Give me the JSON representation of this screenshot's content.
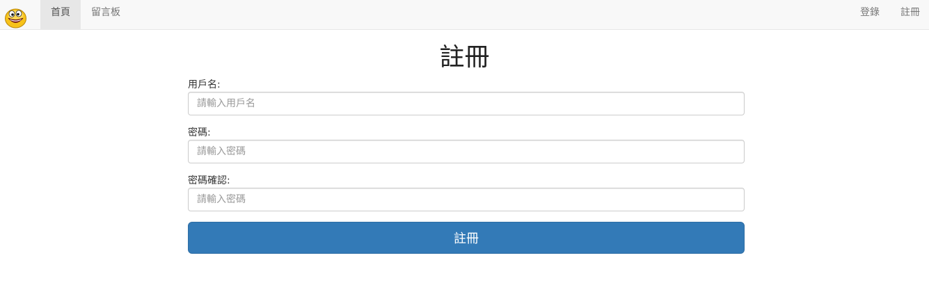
{
  "colors": {
    "navbar_bg": "#f8f8f8",
    "nav_active_bg": "#e7e7e7",
    "primary_button": "#337ab7",
    "logo_face": "#f7c21a"
  },
  "navbar": {
    "logo_icon": "smiley-face-icon",
    "left_items": [
      {
        "label": "首頁",
        "active": true
      },
      {
        "label": "留言板",
        "active": false
      }
    ],
    "right_items": [
      {
        "label": "登錄"
      },
      {
        "label": "註冊"
      }
    ]
  },
  "page_title": "註冊",
  "form": {
    "username": {
      "label": "用戶名:",
      "placeholder": "請輸入用戶名",
      "value": ""
    },
    "password": {
      "label": "密碼:",
      "placeholder": "請輸入密碼",
      "value": ""
    },
    "password_confirm": {
      "label": "密碼確認:",
      "placeholder": "請輸入密碼",
      "value": ""
    },
    "submit_label": "註冊"
  }
}
